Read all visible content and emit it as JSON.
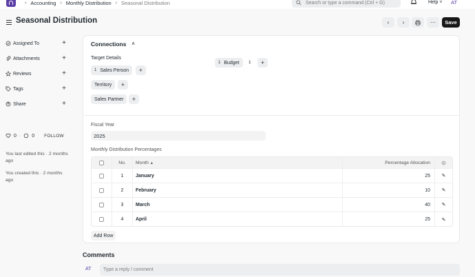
{
  "navbar": {
    "breadcrumbs": [
      "Accounting",
      "Monthly Distribution",
      "Seasonal Distribution"
    ],
    "search_placeholder": "Search or type a command (Ctrl + G)",
    "help_label": "Help",
    "user_initials": "AT"
  },
  "header": {
    "title": "Seasonal Distribution",
    "save_label": "Save"
  },
  "sidebar": {
    "items": [
      {
        "label": "Assigned To",
        "icon": "assign-icon"
      },
      {
        "label": "Attachments",
        "icon": "paperclip-icon"
      },
      {
        "label": "Reviews",
        "icon": "star-icon"
      },
      {
        "label": "Tags",
        "icon": "tag-icon"
      },
      {
        "label": "Share",
        "icon": "share-icon"
      }
    ],
    "likes_count": "0",
    "comments_count": "0",
    "follow_label": "FOLLOW",
    "last_edited": "You last edited this · 2 months ago",
    "created": "You created this · 2 months ago"
  },
  "connections": {
    "title": "Connections",
    "target_label": "Target Details",
    "sales_person": {
      "count": "1",
      "label": "Sales Person"
    },
    "budget": {
      "count": "1",
      "label": "Budget",
      "count2": "1"
    },
    "territory_label": "Territory",
    "sales_partner_label": "Sales Partner"
  },
  "form": {
    "fiscal_year_label": "Fiscal Year",
    "fiscal_year_value": "2025",
    "percentages_label": "Monthly Distribution Percentages"
  },
  "table": {
    "headers": {
      "no": "No.",
      "month": "Month",
      "allocation": "Percentage Allocation"
    },
    "rows": [
      {
        "no": "1",
        "month": "January",
        "allocation": "25"
      },
      {
        "no": "2",
        "month": "February",
        "allocation": "10"
      },
      {
        "no": "3",
        "month": "March",
        "allocation": "40"
      },
      {
        "no": "4",
        "month": "April",
        "allocation": "25"
      }
    ],
    "add_row_label": "Add Row"
  },
  "comments": {
    "title": "Comments",
    "user_initials": "AT",
    "placeholder": "Type a reply / comment"
  }
}
